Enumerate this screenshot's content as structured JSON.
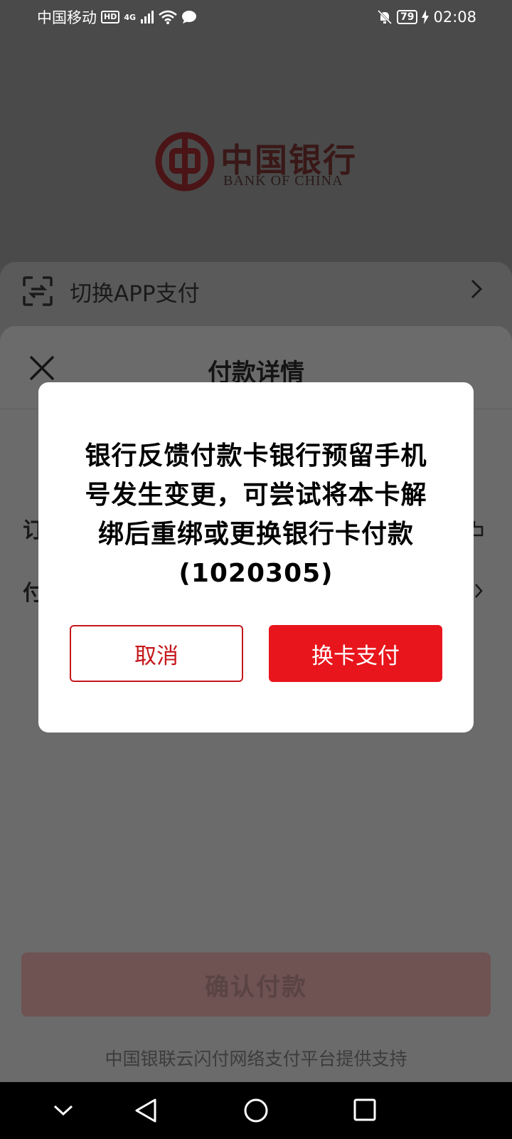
{
  "status_bar": {
    "carrier": "中国移动",
    "hd": "HD",
    "network": "4G",
    "battery": "79",
    "time": "02:08"
  },
  "logo": {
    "cn": "中国银行",
    "en": "BANK OF CHINA"
  },
  "switch_app": {
    "label": "切换APP支付"
  },
  "detail": {
    "title": "付款详情",
    "row1_label_partial": "订",
    "row2_label_partial": "付",
    "confirm_label": "确认付款",
    "support_text": "中国银联云闪付网络支付平台提供支持"
  },
  "dialog": {
    "message": "银行反馈付款卡银行预留手机号发生变更，可尝试将本卡解绑后重绑或更换银行卡付款(1020305)",
    "cancel_label": "取消",
    "switch_card_label": "换卡支付"
  },
  "colors": {
    "accent_red": "#e8151c",
    "cancel_border": "#c5181c"
  }
}
